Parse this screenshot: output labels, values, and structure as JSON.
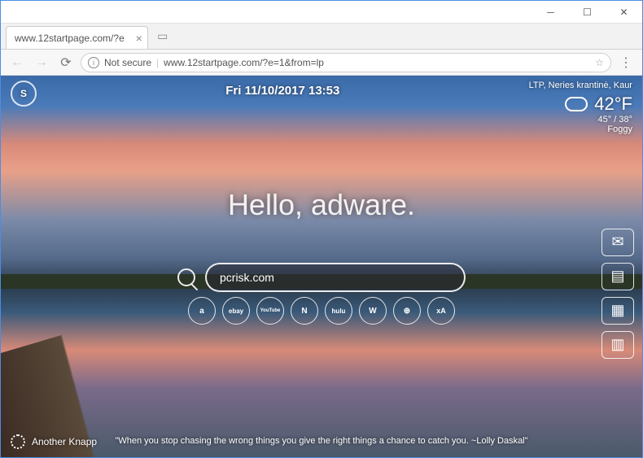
{
  "browser": {
    "tab_title": "www.12startpage.com/?e",
    "url_security": "Not secure",
    "url": "www.12startpage.com/?e=1&from=lp"
  },
  "header": {
    "datetime": "Fri 11/10/2017 13:53",
    "location": "LTP, Neries krantinė, Kaur",
    "temp_main": "42°F",
    "temp_range": "45° / 38°",
    "conditions": "Foggy"
  },
  "center": {
    "greeting": "Hello, adware.",
    "search_value": "pcrisk.com"
  },
  "shortcuts": [
    "a",
    "ebay",
    "YouTube",
    "N",
    "hulu",
    "W",
    "maps",
    "xA"
  ],
  "footer": {
    "user": "Another Knapp",
    "quote": "\"When you stop chasing the wrong things you give the right things a chance to catch you. ~Lolly Daskal\""
  }
}
